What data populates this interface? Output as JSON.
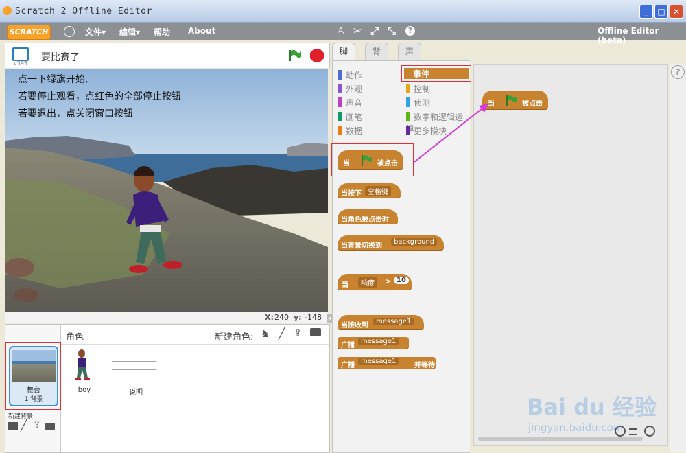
{
  "window": {
    "title": "Scratch 2 Offline Editor"
  },
  "menu": {
    "logo": "SCRATCH",
    "file": "文件▾",
    "edit": "编辑▾",
    "help": "帮助",
    "about": "About",
    "app_label": "Offline Editor (beta)"
  },
  "stage": {
    "version": "v395",
    "project_title": "要比赛了",
    "lines": [
      "点一下绿旗开始,",
      "若要停止观看，点红色的全部停止按钮",
      "若要退出，点关闭窗口按钮"
    ],
    "x_label": "X:",
    "x_value": "240",
    "y_label": "y:",
    "y_value": "-148"
  },
  "sprites": {
    "header": "角色",
    "new_sprite": "新建角色:",
    "stage_name": "舞台",
    "stage_count": "1 背景",
    "new_backdrop": "新建背景",
    "items": [
      {
        "name": "boy"
      },
      {
        "name": "说明"
      }
    ]
  },
  "tabs": [
    "脚本",
    "背景",
    "声音"
  ],
  "categories": {
    "left": [
      {
        "label": "动作",
        "color": "#4a6cd4"
      },
      {
        "label": "外观",
        "color": "#8a55d7"
      },
      {
        "label": "声音",
        "color": "#bb42c3"
      },
      {
        "label": "画笔",
        "color": "#0e9a6c"
      },
      {
        "label": "数据",
        "color": "#ee7d16"
      }
    ],
    "right": [
      {
        "label": "事件",
        "color": "#c88330"
      },
      {
        "label": "控制",
        "color": "#e1a91a"
      },
      {
        "label": "侦测",
        "color": "#2ca5e2"
      },
      {
        "label": "数字和逻辑运算",
        "color": "#5cb712"
      },
      {
        "label": "更多模块",
        "color": "#632d99"
      }
    ]
  },
  "blocks": {
    "when_flag_prefix": "当",
    "when_flag_suffix": "被点击",
    "key_prefix": "当按下",
    "key_value": "空格键",
    "sprite_clicked": "当角色被点击时",
    "backdrop_prefix": "当背景切换到",
    "backdrop_value": "background",
    "sensor_prefix": "当",
    "sensor_value": "响度",
    "sensor_op": ">",
    "sensor_num": "10",
    "receive_prefix": "当接收到",
    "receive_value": "message1",
    "broadcast": "广播",
    "broadcast_value": "message1",
    "broadcast_wait": "广播",
    "broadcast_wait_value": "message1",
    "broadcast_wait_suffix": "并等待"
  },
  "script": {
    "prefix": "当",
    "suffix": "被点击"
  },
  "watermark": {
    "brand": "Bai du 经验",
    "url": "jingyan.baidu.com"
  },
  "colors": {
    "event": "#c88330",
    "highlight": "#e0303a",
    "arrow": "#d63bd6"
  }
}
